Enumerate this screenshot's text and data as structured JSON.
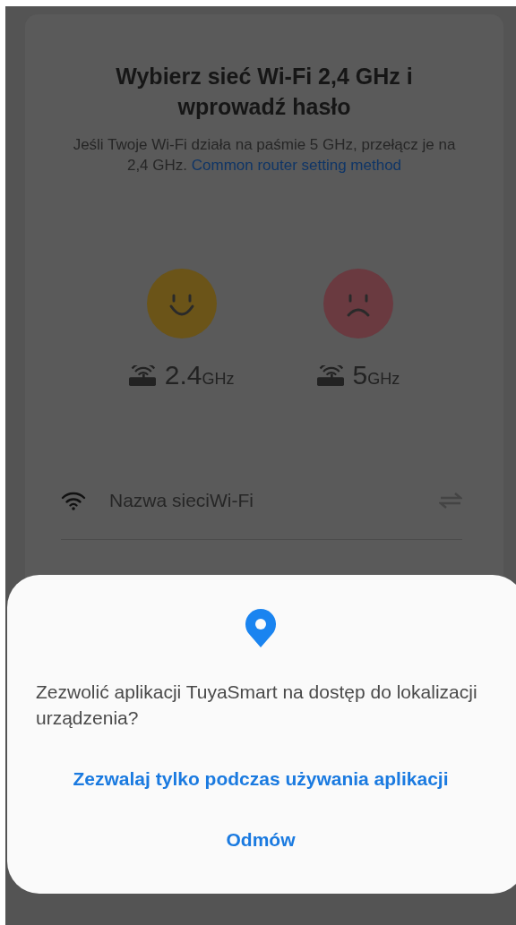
{
  "title": "Wybierz sieć Wi-Fi 2,4 GHz i wprowadź hasło",
  "description": {
    "text": "Jeśli Twoje Wi-Fi działa na paśmie 5 GHz, przełącz je na 2,4 GHz.",
    "link": "Common router setting method"
  },
  "bands": [
    {
      "kind": "good",
      "value": "2.4",
      "unit": "GHz"
    },
    {
      "kind": "bad",
      "value": "5",
      "unit": "GHz"
    }
  ],
  "wifi_field": {
    "placeholder": "Nazwa sieciWi-Fi"
  },
  "dialog": {
    "message": "Zezwolić aplikacji TuyaSmart na dostęp do lokalizacji urządzenia?",
    "buttons": [
      "Zezwalaj tylko podczas używania aplikacji",
      "Odmów"
    ]
  }
}
